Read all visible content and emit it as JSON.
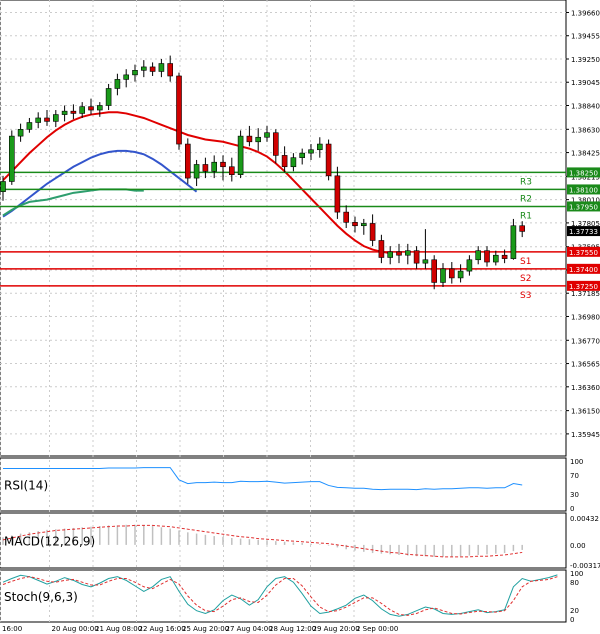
{
  "chart_data": {
    "type": "candlestick",
    "symbol_timeframe": "",
    "price_axis": {
      "min": 1.3575,
      "max": 1.3977,
      "ticks": [
        "1.39660",
        "1.39455",
        "1.39250",
        "1.39045",
        "1.38840",
        "1.38630",
        "1.38425",
        "1.38215",
        "1.38010",
        "1.37805",
        "1.37595",
        "1.37390",
        "1.37185",
        "1.36980",
        "1.36770",
        "1.36565",
        "1.36360",
        "1.36150",
        "1.35945"
      ]
    },
    "time_labels": [
      "16:00",
      "20 Aug 00:00",
      "21 Aug 08:00",
      "22 Aug 16:00",
      "25 Aug 20:00",
      "27 Aug 04:00",
      "28 Aug 12:00",
      "29 Aug 20:00",
      "2 Sep 00:00"
    ],
    "candles": [
      [
        1.3808,
        1.3822,
        1.38,
        1.3817
      ],
      [
        1.3817,
        1.3862,
        1.3814,
        1.3857
      ],
      [
        1.3857,
        1.3868,
        1.3852,
        1.3863
      ],
      [
        1.3863,
        1.3873,
        1.386,
        1.3869
      ],
      [
        1.3869,
        1.3878,
        1.3864,
        1.3873
      ],
      [
        1.3873,
        1.388,
        1.3866,
        1.387
      ],
      [
        1.387,
        1.388,
        1.3865,
        1.3876
      ],
      [
        1.3876,
        1.3884,
        1.387,
        1.3879
      ],
      [
        1.3879,
        1.3885,
        1.3872,
        1.3877
      ],
      [
        1.3877,
        1.3887,
        1.3873,
        1.3883
      ],
      [
        1.3883,
        1.389,
        1.3876,
        1.388
      ],
      [
        1.388,
        1.3887,
        1.3874,
        1.3884
      ],
      [
        1.3884,
        1.3903,
        1.388,
        1.3899
      ],
      [
        1.3899,
        1.3912,
        1.3893,
        1.3907
      ],
      [
        1.3907,
        1.3916,
        1.39,
        1.3911
      ],
      [
        1.3911,
        1.392,
        1.3905,
        1.3915
      ],
      [
        1.3915,
        1.3924,
        1.3909,
        1.3918
      ],
      [
        1.3918,
        1.3922,
        1.391,
        1.3914
      ],
      [
        1.3914,
        1.3925,
        1.3909,
        1.3921
      ],
      [
        1.3921,
        1.3928,
        1.3905,
        1.391
      ],
      [
        1.391,
        1.3913,
        1.3845,
        1.385
      ],
      [
        1.385,
        1.3855,
        1.3815,
        1.382
      ],
      [
        1.382,
        1.3836,
        1.3813,
        1.3832
      ],
      [
        1.3832,
        1.3838,
        1.382,
        1.3826
      ],
      [
        1.3826,
        1.384,
        1.382,
        1.3834
      ],
      [
        1.3834,
        1.384,
        1.3818,
        1.383
      ],
      [
        1.383,
        1.3838,
        1.3817,
        1.3823
      ],
      [
        1.3823,
        1.3862,
        1.382,
        1.3857
      ],
      [
        1.3857,
        1.3866,
        1.3848,
        1.3852
      ],
      [
        1.3852,
        1.3864,
        1.3844,
        1.3856
      ],
      [
        1.3856,
        1.3866,
        1.3852,
        1.386
      ],
      [
        1.386,
        1.3863,
        1.3833,
        1.384
      ],
      [
        1.384,
        1.3848,
        1.3825,
        1.383
      ],
      [
        1.383,
        1.3842,
        1.3826,
        1.3838
      ],
      [
        1.3838,
        1.3846,
        1.3832,
        1.3842
      ],
      [
        1.3842,
        1.385,
        1.3836,
        1.3845
      ],
      [
        1.3845,
        1.3856,
        1.3838,
        1.385
      ],
      [
        1.385,
        1.3854,
        1.3818,
        1.3822
      ],
      [
        1.3822,
        1.383,
        1.3784,
        1.379
      ],
      [
        1.379,
        1.3796,
        1.3776,
        1.3781
      ],
      [
        1.3781,
        1.3786,
        1.3772,
        1.3778
      ],
      [
        1.3778,
        1.3784,
        1.377,
        1.378
      ],
      [
        1.378,
        1.3788,
        1.376,
        1.3765
      ],
      [
        1.3765,
        1.377,
        1.3745,
        1.375
      ],
      [
        1.375,
        1.376,
        1.3744,
        1.3755
      ],
      [
        1.3755,
        1.3762,
        1.3745,
        1.3752
      ],
      [
        1.3752,
        1.3762,
        1.3744,
        1.3756
      ],
      [
        1.3756,
        1.376,
        1.374,
        1.3745
      ],
      [
        1.3745,
        1.3775,
        1.374,
        1.3748
      ],
      [
        1.3748,
        1.3752,
        1.3722,
        1.3728
      ],
      [
        1.3728,
        1.3745,
        1.3724,
        1.374
      ],
      [
        1.374,
        1.3746,
        1.3727,
        1.3732
      ],
      [
        1.3732,
        1.3744,
        1.3728,
        1.3738
      ],
      [
        1.3738,
        1.3752,
        1.3734,
        1.3748
      ],
      [
        1.3748,
        1.376,
        1.3744,
        1.3756
      ],
      [
        1.3756,
        1.376,
        1.3742,
        1.3746
      ],
      [
        1.3746,
        1.3756,
        1.3743,
        1.3752
      ],
      [
        1.3752,
        1.3757,
        1.3745,
        1.3749
      ],
      [
        1.3749,
        1.3784,
        1.3748,
        1.3778
      ],
      [
        1.3778,
        1.3782,
        1.3768,
        1.3773
      ]
    ],
    "moving_averages": [
      {
        "color": "#e00000",
        "values": [
          1.3818,
          1.3826,
          1.3834,
          1.3842,
          1.3849,
          1.3856,
          1.3862,
          1.3867,
          1.3871,
          1.3874,
          1.3876,
          1.3877,
          1.3878,
          1.3878,
          1.3877,
          1.3875,
          1.3873,
          1.387,
          1.3867,
          1.3864,
          1.3861,
          1.3858,
          1.3856,
          1.3854,
          1.3853,
          1.3852,
          1.385,
          1.3848,
          1.3846,
          1.3843,
          1.3839,
          1.3833,
          1.3826,
          1.3818,
          1.381,
          1.3802,
          1.3794,
          1.3786,
          1.3778,
          1.3771,
          1.3765,
          1.376,
          1.3757,
          1.3755,
          1.3754
        ]
      },
      {
        "color": "#3355cc",
        "values": [
          1.3786,
          1.3791,
          1.3797,
          1.3803,
          1.3809,
          1.3815,
          1.382,
          1.3825,
          1.383,
          1.3834,
          1.3838,
          1.3841,
          1.3843,
          1.3844,
          1.3844,
          1.3843,
          1.3841,
          1.3837,
          1.3832,
          1.3826,
          1.382,
          1.3814,
          1.3808
        ]
      },
      {
        "color": "#2e9e6e",
        "values": [
          1.3787,
          1.3792,
          1.3796,
          1.3799,
          1.38,
          1.3801,
          1.3803,
          1.3805,
          1.3807,
          1.3808,
          1.3809,
          1.381,
          1.381,
          1.381,
          1.381,
          1.3809,
          1.3809
        ]
      }
    ],
    "levels": [
      {
        "name": "R3",
        "price": 1.3825,
        "label": "1.38250",
        "color": "#1a8a1a"
      },
      {
        "name": "R2",
        "price": 1.381,
        "label": "1.38100",
        "color": "#1a8a1a"
      },
      {
        "name": "R1",
        "price": 1.3795,
        "label": "1.37950",
        "color": "#1a8a1a"
      },
      {
        "name": "S1",
        "price": 1.3755,
        "label": "1.37550",
        "color": "#e00000"
      },
      {
        "name": "S2",
        "price": 1.374,
        "label": "1.37400",
        "color": "#e00000"
      },
      {
        "name": "S3",
        "price": 1.3725,
        "label": "1.37250",
        "color": "#e00000"
      }
    ],
    "current_price": "1.37733",
    "indicators": [
      {
        "name": "RSI(14)",
        "range": [
          0,
          100
        ],
        "ticks": [
          "100",
          "70",
          "30",
          "0"
        ],
        "color": "#1e90ff",
        "values": [
          84,
          84,
          84,
          84,
          84,
          84,
          84,
          84,
          84,
          84,
          84,
          84,
          85,
          85,
          85,
          85,
          86,
          86,
          86,
          86,
          60,
          52,
          54,
          54,
          55,
          54,
          54,
          57,
          56,
          56,
          57,
          55,
          53,
          54,
          55,
          56,
          56,
          48,
          44,
          43,
          42,
          42,
          40,
          39,
          40,
          40,
          40,
          39,
          41,
          40,
          41,
          41,
          42,
          43,
          43,
          42,
          43,
          43,
          52,
          49
        ]
      },
      {
        "name": "MACD(12,26,9)",
        "range": [
          -0.0032,
          0.0046
        ],
        "ticks": [
          "0.00432",
          "0.00",
          "-0.003178"
        ],
        "color": "#c0c0c0",
        "signal_color": "#e03030",
        "histogram": [
          0.0012,
          0.0015,
          0.0018,
          0.002,
          0.0022,
          0.0024,
          0.0025,
          0.0026,
          0.0027,
          0.0028,
          0.0029,
          0.003,
          0.0031,
          0.0031,
          0.0032,
          0.0032,
          0.0031,
          0.003,
          0.0028,
          0.0026,
          0.0023,
          0.002,
          0.0018,
          0.0016,
          0.0014,
          0.0013,
          0.0011,
          0.001,
          0.0009,
          0.0008,
          0.0007,
          0.0006,
          0.0005,
          0.0004,
          0.0003,
          0.0002,
          0.0001,
          -0.0001,
          -0.0004,
          -0.0007,
          -0.0009,
          -0.0011,
          -0.0013,
          -0.0014,
          -0.0015,
          -0.0016,
          -0.0017,
          -0.0018,
          -0.0018,
          -0.0019,
          -0.0019,
          -0.0019,
          -0.0018,
          -0.0017,
          -0.0016,
          -0.0015,
          -0.0014,
          -0.0013,
          -0.001,
          -0.0008
        ],
        "signal": [
          0.0008,
          0.0011,
          0.0014,
          0.0017,
          0.0019,
          0.0021,
          0.0023,
          0.0024,
          0.0025,
          0.0026,
          0.0027,
          0.0028,
          0.0029,
          0.003,
          0.003,
          0.0031,
          0.0031,
          0.0031,
          0.003,
          0.0029,
          0.0027,
          0.0025,
          0.0023,
          0.0021,
          0.0019,
          0.0017,
          0.0015,
          0.0013,
          0.0012,
          0.001,
          0.0009,
          0.0008,
          0.0007,
          0.0006,
          0.0005,
          0.0004,
          0.0003,
          0.0002,
          0.0,
          -0.0002,
          -0.0004,
          -0.0006,
          -0.0008,
          -0.001,
          -0.0012,
          -0.0013,
          -0.0015,
          -0.0016,
          -0.0017,
          -0.0018,
          -0.0019,
          -0.0019,
          -0.0019,
          -0.0019,
          -0.0018,
          -0.0018,
          -0.0017,
          -0.0016,
          -0.0014,
          -0.0012
        ]
      },
      {
        "name": "Stoch(9,6,3)",
        "range": [
          0,
          100
        ],
        "ticks": [
          "100",
          "80",
          "20",
          "0"
        ],
        "color": "#20a0a0",
        "signal_color": "#e03030",
        "values": [
          80,
          88,
          95,
          92,
          84,
          76,
          82,
          90,
          84,
          75,
          70,
          78,
          88,
          92,
          84,
          72,
          60,
          70,
          86,
          92,
          60,
          32,
          18,
          12,
          20,
          40,
          52,
          44,
          30,
          42,
          70,
          88,
          92,
          80,
          55,
          28,
          12,
          15,
          22,
          30,
          45,
          52,
          40,
          22,
          10,
          6,
          10,
          18,
          26,
          22,
          12,
          10,
          12,
          16,
          20,
          14,
          16,
          20,
          70,
          88,
          82,
          86,
          90,
          96
        ],
        "signal": [
          75,
          82,
          88,
          92,
          88,
          82,
          80,
          84,
          86,
          80,
          74,
          74,
          82,
          88,
          88,
          80,
          70,
          66,
          76,
          86,
          76,
          50,
          30,
          18,
          16,
          28,
          42,
          46,
          38,
          36,
          52,
          74,
          88,
          88,
          72,
          48,
          26,
          16,
          18,
          26,
          36,
          46,
          46,
          34,
          20,
          10,
          8,
          12,
          20,
          24,
          18,
          12,
          11,
          14,
          17,
          16,
          15,
          18,
          40,
          70,
          82,
          84,
          86,
          92
        ]
      }
    ]
  }
}
